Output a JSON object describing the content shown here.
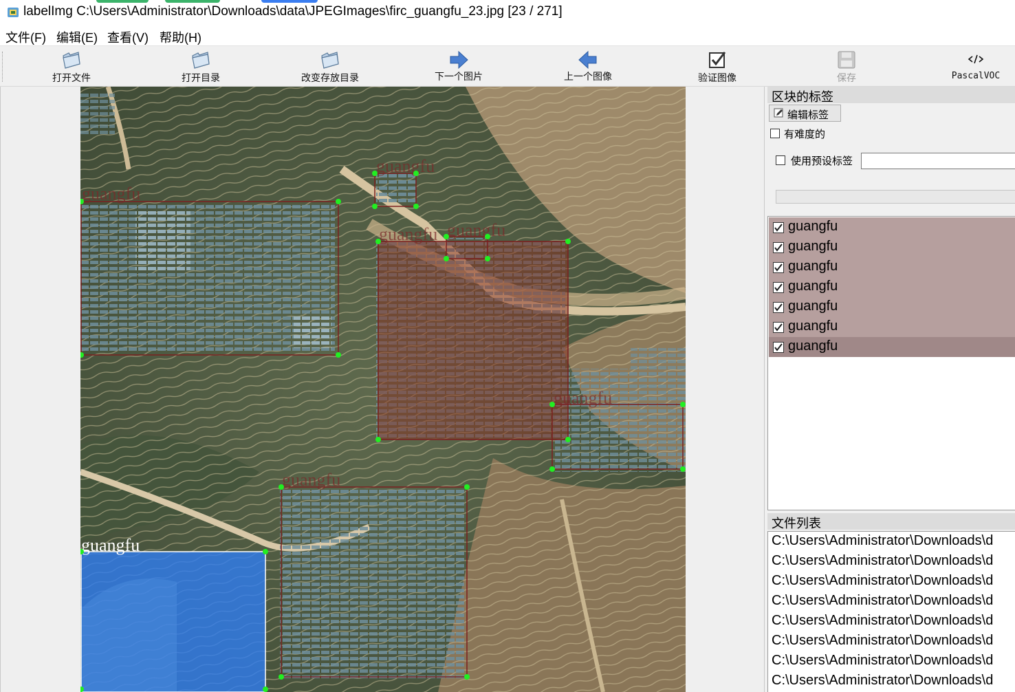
{
  "window": {
    "title": "labelImg C:\\Users\\Administrator\\Downloads\\data\\JPEGImages\\firc_guangfu_23.jpg [23 / 271]"
  },
  "menu": [
    "文件(F)",
    "编辑(E)",
    "查看(V)",
    "帮助(H)"
  ],
  "toolbar": {
    "open_file": "打开文件",
    "open_dir": "打开目录",
    "change_save_dir": "改变存放目录",
    "next_image": "下一个图片",
    "prev_image": "上一个图像",
    "verify": "验证图像",
    "save": "保存",
    "format": "PascalVOC"
  },
  "dock": {
    "box_labels_title": "区块的标签",
    "edit_label": "编辑标签",
    "difficult": "有难度的",
    "use_default_label": "使用预设标签",
    "default_label_value": "",
    "labels": [
      "guangfu",
      "guangfu",
      "guangfu",
      "guangfu",
      "guangfu",
      "guangfu",
      "guangfu"
    ],
    "file_list_title": "文件列表",
    "files": [
      "C:\\Users\\Administrator\\Downloads\\d",
      "C:\\Users\\Administrator\\Downloads\\d",
      "C:\\Users\\Administrator\\Downloads\\d",
      "C:\\Users\\Administrator\\Downloads\\d",
      "C:\\Users\\Administrator\\Downloads\\d",
      "C:\\Users\\Administrator\\Downloads\\d",
      "C:\\Users\\Administrator\\Downloads\\d",
      "C:\\Users\\Administrator\\Downloads\\d"
    ]
  },
  "canvas": {
    "box_label": "guangfu"
  },
  "colors": {
    "label_row_bg": "#b69f9e",
    "label_row_selected_bg": "#a08888",
    "box_stroke": "#7a2020",
    "vertex": "#22ff22",
    "selected_fill": "#2f7df0"
  }
}
